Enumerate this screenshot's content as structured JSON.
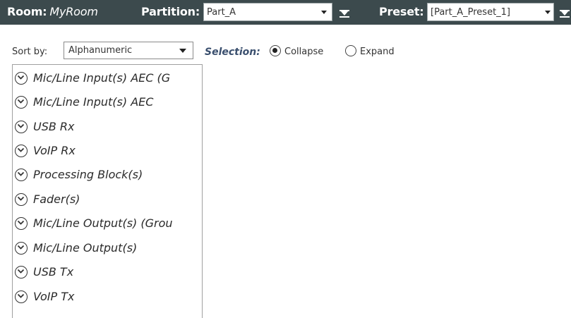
{
  "header": {
    "room_label": "Room:",
    "room_value": "MyRoom",
    "partition_label": "Partition:",
    "partition_value": "Part_A",
    "preset_label": "Preset:",
    "preset_value": "[Part_A_Preset_1]",
    "icons": [
      "dropdown-arrow-icon",
      "pin-icon"
    ]
  },
  "toolbar": {
    "sort_label": "Sort by:",
    "sort_value": "Alphanumeric",
    "selection_label": "Selection:",
    "collapse_label": "Collapse",
    "expand_label": "Expand",
    "selected_mode": "Collapse"
  },
  "list": {
    "items": [
      {
        "label": "Mic/Line Input(s) AEC (G"
      },
      {
        "label": "Mic/Line Input(s) AEC"
      },
      {
        "label": "USB Rx"
      },
      {
        "label": "VoIP Rx"
      },
      {
        "label": "Processing Block(s)"
      },
      {
        "label": "Fader(s)"
      },
      {
        "label": "Mic/Line Output(s) (Grou"
      },
      {
        "label": "Mic/Line Output(s)"
      },
      {
        "label": "USB Tx"
      },
      {
        "label": "VoIP Tx"
      }
    ],
    "item_icon": "chevron-down-circle-icon"
  },
  "colors": {
    "header_bg": "#3c4a4d",
    "selection_label": "#3a4f6e"
  }
}
